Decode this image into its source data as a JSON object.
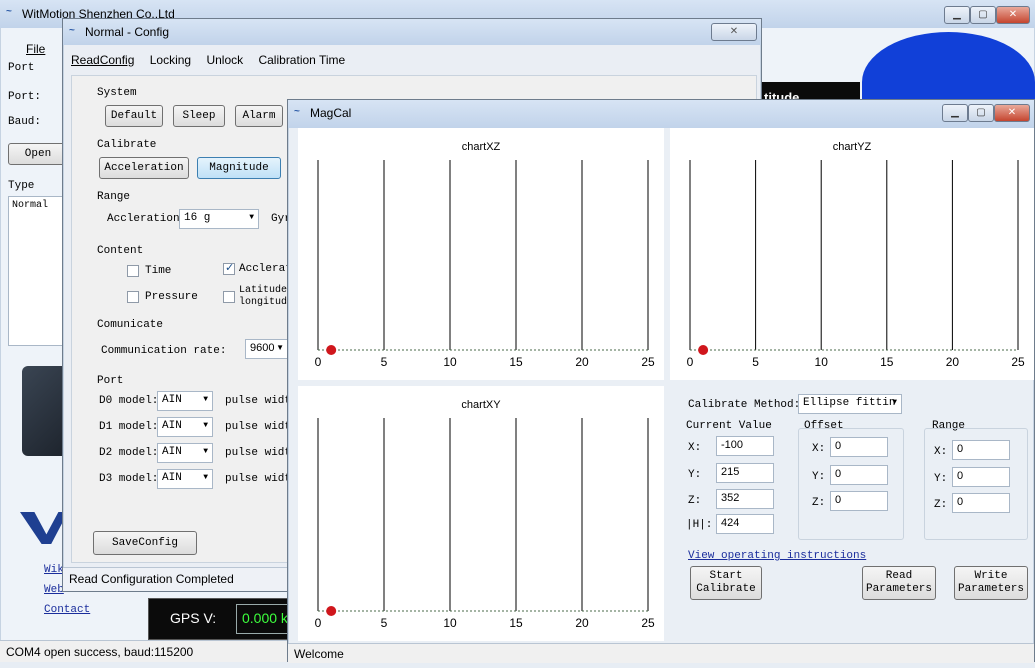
{
  "main": {
    "title": "WitMotion Shenzhen Co.,Ltd",
    "menu": {
      "file": "File"
    },
    "left": {
      "port_section": "Port",
      "port_label": "Port:",
      "baud_label": "Baud:",
      "open_button": "Open",
      "type_section": "Type",
      "type_value": "Normal"
    },
    "links": {
      "wiki": "Wiki",
      "web": "Web",
      "contact": "Contact"
    },
    "bg_label": "titude",
    "gps_label": "GPS V:",
    "gps_value": "0.000 k",
    "status": "COM4 open success, baud:115200"
  },
  "config": {
    "title": "Normal - Config",
    "menu": [
      "ReadConfig",
      "Locking",
      "Unlock",
      "Calibration Time"
    ],
    "system": {
      "label": "System",
      "buttons": [
        "Default",
        "Sleep",
        "Alarm"
      ]
    },
    "calibrate": {
      "label": "Calibrate",
      "buttons": [
        "Acceleration",
        "Magnitude"
      ]
    },
    "range": {
      "label": "Range",
      "accel_label": "Accleration:",
      "accel_value": "16 g",
      "gyro_label": "Gyr"
    },
    "content": {
      "label": "Content",
      "time": "Time",
      "accel": "Acclerati",
      "pressure": "Pressure",
      "latlon1": "Latitude",
      "latlon2": "longitude"
    },
    "comm": {
      "label": "Comunicate",
      "rate_label": "Communication rate:",
      "rate_value": "9600"
    },
    "port": {
      "label": "Port",
      "rows": [
        {
          "label": "D0 model:",
          "value": "AIN",
          "pulse": "pulse width"
        },
        {
          "label": "D1 model:",
          "value": "AIN",
          "pulse": "pulse width"
        },
        {
          "label": "D2 model:",
          "value": "AIN",
          "pulse": "pulse width"
        },
        {
          "label": "D3 model:",
          "value": "AIN",
          "pulse": "pulse width"
        }
      ]
    },
    "save_button": "SaveConfig",
    "status": "Read Configuration Completed"
  },
  "magcal": {
    "title": "MagCal",
    "ticks": [
      "0",
      "5",
      "10",
      "15",
      "20",
      "25"
    ],
    "charts": {
      "xz": "chartXZ",
      "yz": "chartYZ",
      "xy": "chartXY"
    },
    "method_label": "Calibrate Method:",
    "method_value": "Ellipse fittin",
    "current": {
      "label": "Current Value",
      "x_label": "X:",
      "x": "-100",
      "y_label": "Y:",
      "y": "215",
      "z_label": "Z:",
      "z": "352",
      "h_label": "|H|:",
      "h": "424"
    },
    "offset": {
      "label": "Offset",
      "x_label": "X:",
      "x": "0",
      "y_label": "Y:",
      "y": "0",
      "z_label": "Z:",
      "z": "0"
    },
    "range": {
      "label": "Range",
      "x_label": "X:",
      "x": "0",
      "y_label": "Y:",
      "y": "0",
      "z_label": "Z:",
      "z": "0"
    },
    "instructions_link": "View operating instructions",
    "start1": "Start",
    "start2": "Calibrate",
    "read1": "Read",
    "read2": "Parameters",
    "write1": "Write",
    "write2": "Parameters",
    "status": "Welcome"
  }
}
